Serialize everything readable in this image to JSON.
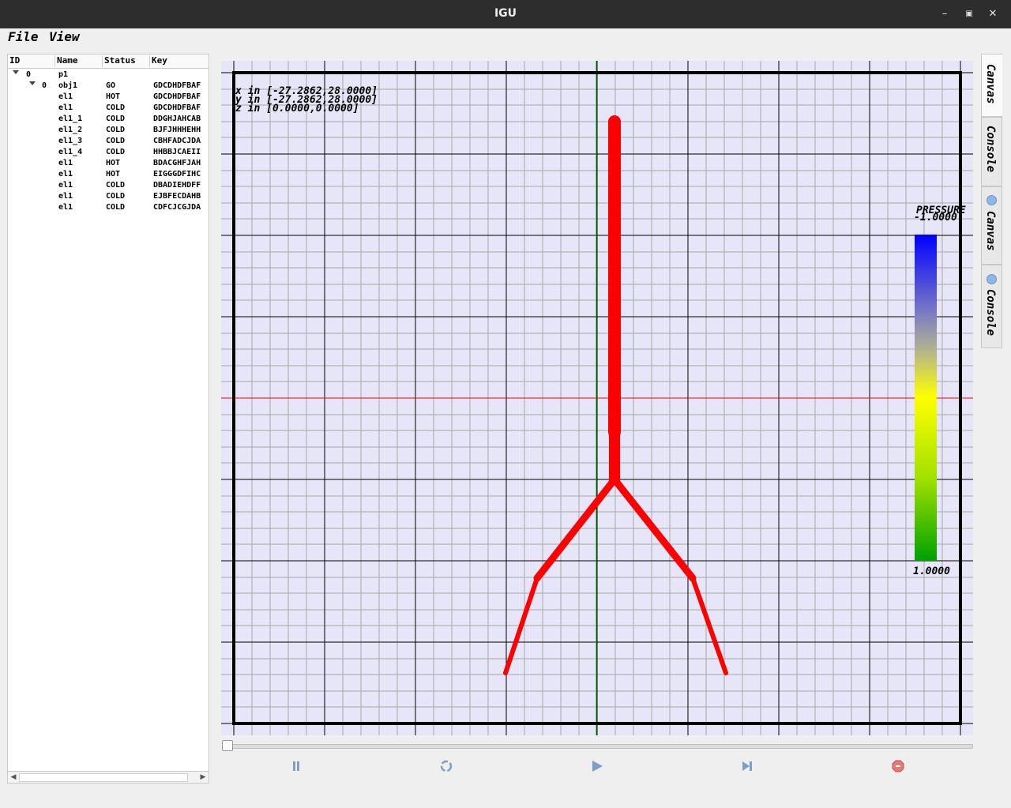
{
  "window": {
    "title": "IGU"
  },
  "menubar": {
    "items": [
      "File",
      "View"
    ]
  },
  "tree": {
    "columns": [
      "ID",
      "Name",
      "Status",
      "Key"
    ],
    "rows": [
      {
        "id": "0",
        "name": "p1",
        "status": "",
        "key": "",
        "level": 0
      },
      {
        "id": "0",
        "name": "obj1",
        "status": "GO",
        "key": "GDCDHDFBAF",
        "level": 1
      },
      {
        "id": "",
        "name": "el1",
        "status": "HOT",
        "key": "GDCDHDFBAF",
        "level": 2
      },
      {
        "id": "",
        "name": "el1",
        "status": "COLD",
        "key": "GDCDHDFBAF",
        "level": 2
      },
      {
        "id": "",
        "name": "el1_1",
        "status": "COLD",
        "key": "DDGHJAHCAB",
        "level": 2
      },
      {
        "id": "",
        "name": "el1_2",
        "status": "COLD",
        "key": "BJFJHHHEHH",
        "level": 2
      },
      {
        "id": "",
        "name": "el1_3",
        "status": "COLD",
        "key": "CBHFADCJDA",
        "level": 2
      },
      {
        "id": "",
        "name": "el1_4",
        "status": "COLD",
        "key": "HHBBJCAEII",
        "level": 2
      },
      {
        "id": "",
        "name": "el1",
        "status": "HOT",
        "key": "BDACGHFJAH",
        "level": 2
      },
      {
        "id": "",
        "name": "el1",
        "status": "HOT",
        "key": "EIGGGDFIHC",
        "level": 2
      },
      {
        "id": "",
        "name": "el1",
        "status": "COLD",
        "key": "DBADIEHDFF",
        "level": 2
      },
      {
        "id": "",
        "name": "el1",
        "status": "COLD",
        "key": "EJBFECDAHB",
        "level": 2
      },
      {
        "id": "",
        "name": "el1",
        "status": "COLD",
        "key": "CDFCJCGJDA",
        "level": 2
      }
    ]
  },
  "canvas": {
    "range_text": [
      "x in [-27.2862,28.0000]",
      "y in [-27.2862,28.0000]",
      "z in [0.0000,0.0000]"
    ],
    "colorbar": {
      "label": "PRESSURE",
      "max_label": "-1.0000",
      "min_label": "1.0000"
    },
    "colors": {
      "background": "#e6e6f8",
      "grid_minor": "#a8a8a8",
      "grid_major": "#000000",
      "tree": "#ff0000",
      "axis_x": "#ff0000",
      "axis_y": "#00aa00"
    }
  },
  "playback": {
    "buttons": [
      "pause-icon",
      "reload-icon",
      "play-icon",
      "step-forward-icon",
      "stop-icon"
    ],
    "progress": 0
  },
  "side_tabs": [
    {
      "label": "Canvas",
      "icon": ""
    },
    {
      "label": "Console",
      "icon": ""
    },
    {
      "label": "Canvas",
      "icon": "plus-icon"
    },
    {
      "label": "Console",
      "icon": "plus-icon"
    }
  ]
}
